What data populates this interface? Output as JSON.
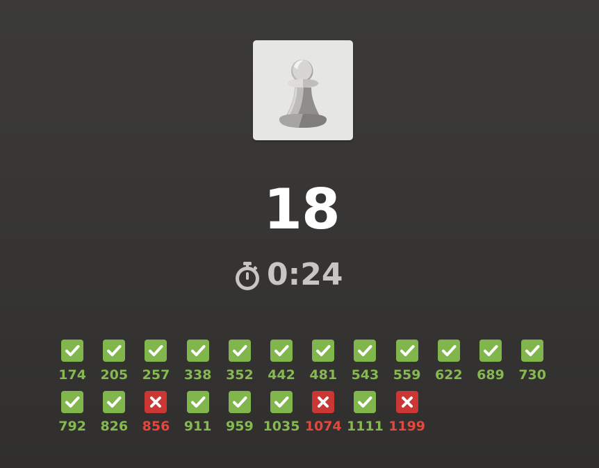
{
  "piece": {
    "icon": "white-pawn-icon",
    "background": "#e6e6e4"
  },
  "score": "18",
  "timer": {
    "icon": "stopwatch-icon",
    "time": "0:24"
  },
  "colors": {
    "correct": "#81b64c",
    "incorrect": "#cb3734"
  },
  "results": [
    {
      "rating": "174",
      "status": "correct"
    },
    {
      "rating": "205",
      "status": "correct"
    },
    {
      "rating": "257",
      "status": "correct"
    },
    {
      "rating": "338",
      "status": "correct"
    },
    {
      "rating": "352",
      "status": "correct"
    },
    {
      "rating": "442",
      "status": "correct"
    },
    {
      "rating": "481",
      "status": "correct"
    },
    {
      "rating": "543",
      "status": "correct"
    },
    {
      "rating": "559",
      "status": "correct"
    },
    {
      "rating": "622",
      "status": "correct"
    },
    {
      "rating": "689",
      "status": "correct"
    },
    {
      "rating": "730",
      "status": "correct"
    },
    {
      "rating": "792",
      "status": "correct"
    },
    {
      "rating": "826",
      "status": "correct"
    },
    {
      "rating": "856",
      "status": "incorrect"
    },
    {
      "rating": "911",
      "status": "correct"
    },
    {
      "rating": "959",
      "status": "correct"
    },
    {
      "rating": "1035",
      "status": "correct"
    },
    {
      "rating": "1074",
      "status": "incorrect"
    },
    {
      "rating": "1111",
      "status": "correct"
    },
    {
      "rating": "1199",
      "status": "incorrect"
    }
  ]
}
